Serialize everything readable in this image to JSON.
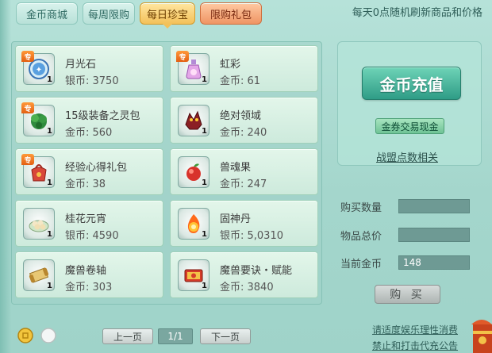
{
  "tabs": [
    {
      "label": "金币商城"
    },
    {
      "label": "每周限购"
    },
    {
      "label": "每日珍宝"
    },
    {
      "label": "限购礼包"
    }
  ],
  "notice": "每天0点随机刷新商品和价格",
  "items": [
    {
      "name": "月光石",
      "price": "银币: 3750",
      "qty": "1",
      "badge": "专",
      "icon": "moonstone-icon"
    },
    {
      "name": "虹彩",
      "price": "金币: 61",
      "qty": "1",
      "badge": "专",
      "icon": "potion-icon"
    },
    {
      "name": "15级装备之灵包",
      "price": "金币: 560",
      "qty": "1",
      "badge": "专",
      "icon": "equipment-spirit-pack-icon"
    },
    {
      "name": "绝对领域",
      "price": "金币: 240",
      "qty": "1",
      "badge": "",
      "icon": "dragon-icon"
    },
    {
      "name": "经验心得礼包",
      "price": "金币: 38",
      "qty": "1",
      "badge": "专",
      "icon": "gift-bag-icon"
    },
    {
      "name": "兽魂果",
      "price": "金币: 247",
      "qty": "1",
      "badge": "",
      "icon": "fruit-icon"
    },
    {
      "name": "桂花元宵",
      "price": "银币: 4590",
      "qty": "1",
      "badge": "",
      "icon": "rice-ball-icon"
    },
    {
      "name": "固神丹",
      "price": "银币: 5,0310",
      "qty": "1",
      "badge": "",
      "icon": "fire-pill-icon"
    },
    {
      "name": "魔兽卷轴",
      "price": "金币: 303",
      "qty": "1",
      "badge": "",
      "icon": "scroll-icon"
    },
    {
      "name": "魔兽要诀・赋能",
      "price": "金币: 3840",
      "qty": "1",
      "badge": "",
      "icon": "skill-book-icon"
    }
  ],
  "recharge": {
    "button": "金币充值",
    "exchange": "金券交易现金",
    "alliance": "战盟点数相关"
  },
  "form": {
    "quantity_label": "购买数量",
    "quantity_value": "",
    "total_label": "物品总价",
    "total_value": "",
    "gold_label": "当前金币",
    "gold_value": "148",
    "buy": "购 买"
  },
  "pagination": {
    "prev": "上一页",
    "page": "1/1",
    "next": "下一页"
  },
  "footer": {
    "line1": "请适度娱乐理性消费",
    "line2": "禁止和打击代充公告"
  }
}
